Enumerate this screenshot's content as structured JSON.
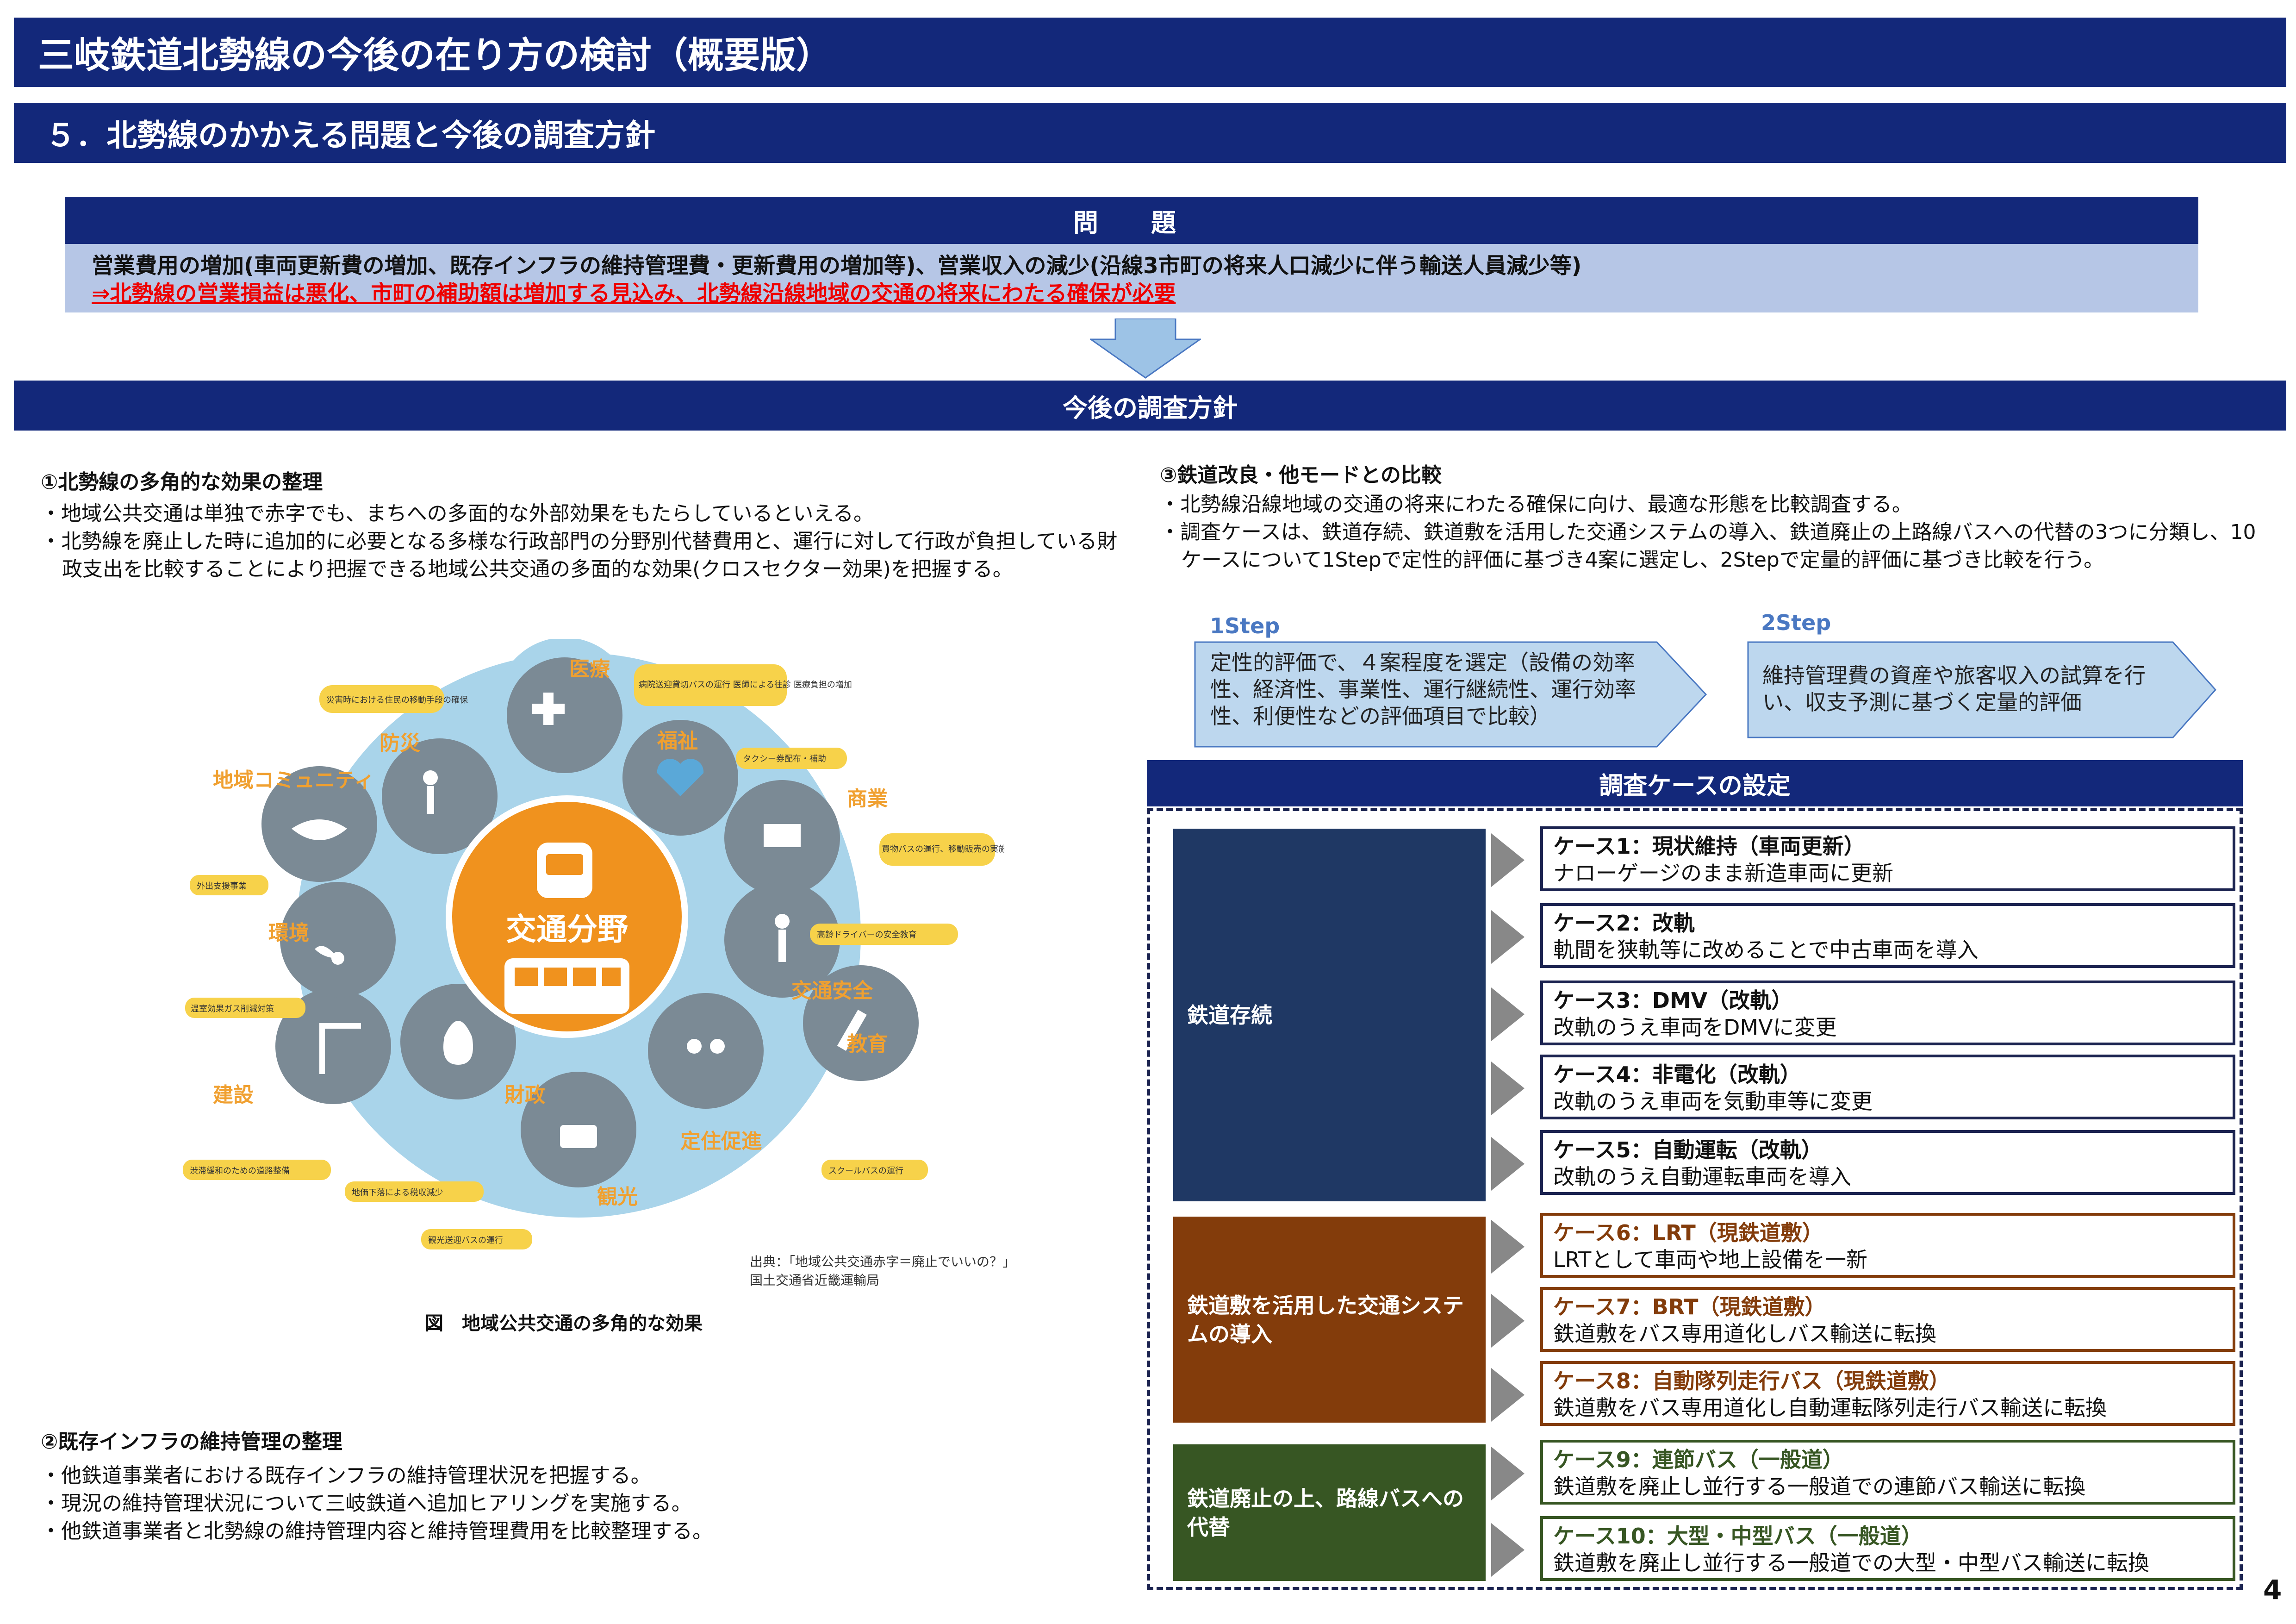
{
  "header": {
    "title": "三岐鉄道北勢線の今後の在り方の検討（概要版）",
    "subtitle": "５．北勢線のかかえる問題と今後の調査方針"
  },
  "problem": {
    "heading": "問　題",
    "line1": "営業費用の増加(車両更新費の増加、既存インフラの維持管理費・更新費用の増加等)、営業収入の減少(沿線3市町の将来人口減少に伴う輸送人員減少等)",
    "line2": "⇒北勢線の営業損益は悪化、市町の補助額は増加する見込み、北勢線沿線地域の交通の将来にわたる確保が必要"
  },
  "policy": {
    "heading": "今後の調査方針"
  },
  "section1": {
    "title": "①北勢線の多角的な効果の整理",
    "bullets": [
      "・地域公共交通は単独で赤字でも、まちへの多面的な外部効果をもたらしているといえる。",
      "・北勢線を廃止した時に追加的に必要となる多様な行政部門の分野別代替費用と、運行に対して行政が負担している財政支出を比較することにより把握できる地域公共交通の多面的な効果(クロスセクター効果)を把握する。"
    ]
  },
  "diagram": {
    "center": "交通分野",
    "sectors": [
      "医療",
      "福祉",
      "商業",
      "交通安全",
      "教育",
      "定住促進",
      "観光",
      "財政",
      "建設",
      "環境",
      "地域コミュニティ",
      "防災"
    ],
    "notes": [
      "災害時における住民の移動手段の確保",
      "病院送迎貸切バスの運行 医師による往診 医療負担の増加",
      "タクシー券配布・補助",
      "買物バスの運行、移動販売の実施",
      "外出支援事業",
      "高齢ドライバーの安全教育",
      "温室効果ガス削減対策",
      "渋滞緩和のための道路整備",
      "地価下落による税収減少",
      "スクールバスの運行",
      "観光送迎バスの運行"
    ],
    "source_line1": "出典：「地域公共交通赤字＝廃止でいいの？」",
    "source_line2": "国土交通省近畿運輸局",
    "caption": "図　地域公共交通の多角的な効果"
  },
  "section2": {
    "title": "②既存インフラの維持管理の整理",
    "bullets": [
      "・他鉄道事業者における既存インフラの維持管理状況を把握する。",
      "・現況の維持管理状況について三岐鉄道へ追加ヒアリングを実施する。",
      "・他鉄道事業者と北勢線の維持管理内容と維持管理費用を比較整理する。"
    ]
  },
  "section3": {
    "title": "③鉄道改良・他モードとの比較",
    "bullets": [
      "・北勢線沿線地域の交通の将来にわたる確保に向け、最適な形態を比較調査する。",
      "・調査ケースは、鉄道存続、鉄道敷を活用した交通システムの導入、鉄道廃止の上路線バスへの代替の3つに分類し、10ケースについて1Stepで定性的評価に基づき4案に選定し、2Stepで定量的評価に基づき比較を行う。"
    ],
    "step1_label": "1Step",
    "step1_text": "定性的評価で、４案程度を選定（設備の効率性、経済性、事業性、運行継続性、運行効率性、利便性などの評価項目で比較）",
    "step2_label": "2Step",
    "step2_text": "維持管理費の資産や旅客収入の試算を行い、収支予測に基づく定量的評価"
  },
  "cases": {
    "heading": "調査ケースの設定",
    "categories": [
      "鉄道存続",
      "鉄道敷を活用した交通システムの導入",
      "鉄道廃止の上、路線バスへの代替"
    ],
    "items": [
      {
        "title": "ケース1：現状維持（車両更新）",
        "desc": "ナローゲージのまま新造車両に更新"
      },
      {
        "title": "ケース2：改軌",
        "desc": "軌間を狭軌等に改めることで中古車両を導入"
      },
      {
        "title": "ケース3：DMV（改軌）",
        "desc": "改軌のうえ車両をDMVに変更"
      },
      {
        "title": "ケース4：非電化（改軌）",
        "desc": "改軌のうえ車両を気動車等に変更"
      },
      {
        "title": "ケース5：自動運転（改軌）",
        "desc": "改軌のうえ自動運転車両を導入"
      },
      {
        "title": "ケース6：LRT（現鉄道敷）",
        "desc": "LRTとして車両や地上設備を一新"
      },
      {
        "title": "ケース7：BRT（現鉄道敷）",
        "desc": "鉄道敷をバス専用道化しバス輸送に転換"
      },
      {
        "title": "ケース8：自動隊列走行バス（現鉄道敷）",
        "desc": "鉄道敷をバス専用道化し自動運転隊列走行バス輸送に転換"
      },
      {
        "title": "ケース9：連節バス（一般道）",
        "desc": "鉄道敷を廃止し並行する一般道での連節バス輸送に転換"
      },
      {
        "title": "ケース10：大型・中型バス（一般道）",
        "desc": "鉄道敷を廃止し並行する一般道での大型・中型バス輸送に転換"
      }
    ]
  },
  "page_number": "4",
  "colors": {
    "navy": "#13287a",
    "cat_rail": "#1f3864",
    "cat_brown": "#833c0b",
    "cat_green": "#375623",
    "problem_bg": "#b6c6e6",
    "center_orange": "#f0921e",
    "sector_orange": "#f0a030"
  }
}
